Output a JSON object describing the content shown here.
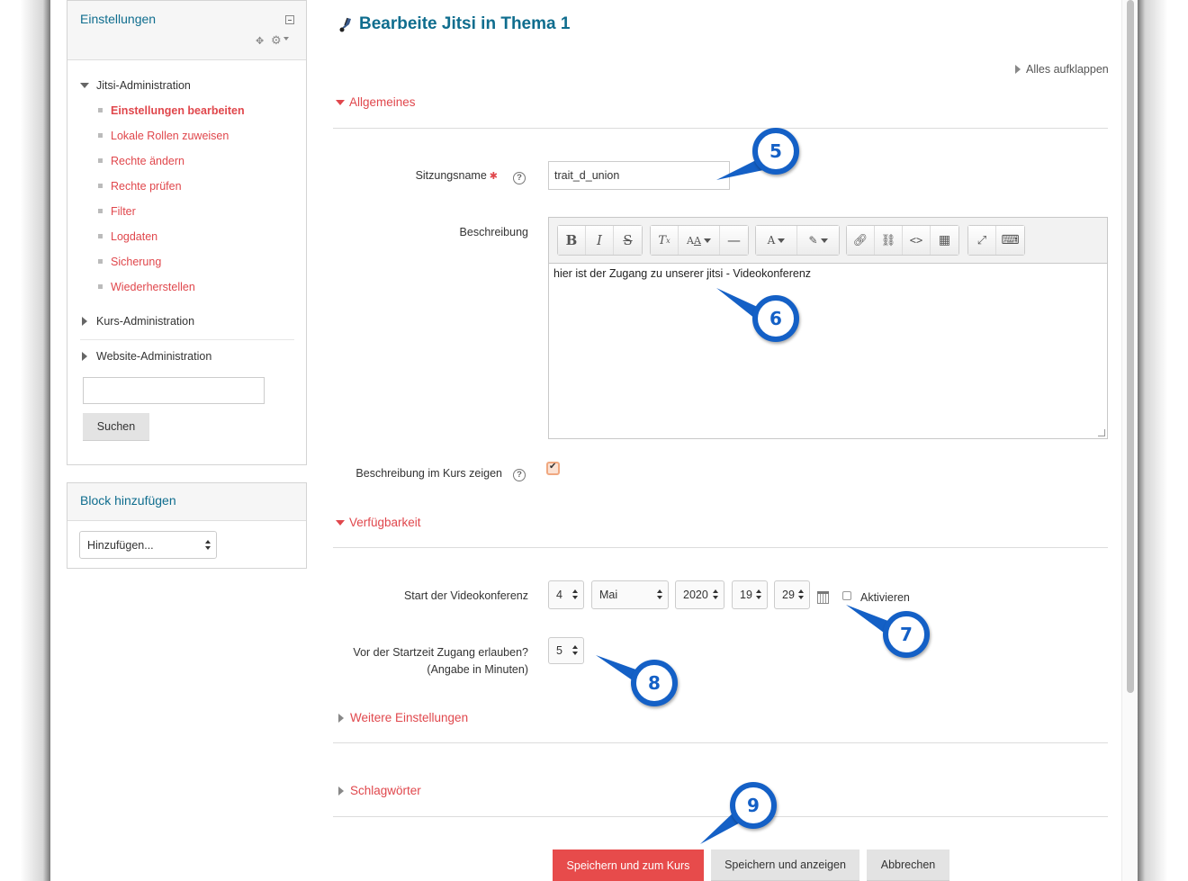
{
  "sidebar": {
    "settings_block": {
      "title": "Einstellungen",
      "tree": [
        {
          "label": "Jitsi-Administration",
          "expanded": true,
          "children": [
            {
              "label": "Einstellungen bearbeiten",
              "active": true
            },
            {
              "label": "Lokale Rollen zuweisen"
            },
            {
              "label": "Rechte ändern"
            },
            {
              "label": "Rechte prüfen"
            },
            {
              "label": "Filter"
            },
            {
              "label": "Logdaten"
            },
            {
              "label": "Sicherung"
            },
            {
              "label": "Wiederherstellen"
            }
          ]
        },
        {
          "label": "Kurs-Administration",
          "expanded": false
        },
        {
          "label": "Website-Administration",
          "expanded": false
        }
      ],
      "search_value": "",
      "search_button": "Suchen"
    },
    "add_block": {
      "title": "Block hinzufügen",
      "select_value": "Hinzufügen..."
    }
  },
  "main": {
    "title": "Bearbeite Jitsi in Thema 1",
    "expand_all": "Alles aufklappen",
    "sections": {
      "general": "Allgemeines",
      "availability": "Verfügbarkeit",
      "more_settings": "Weitere Einstellungen",
      "tags": "Schlagwörter"
    },
    "fields": {
      "session_name": {
        "label": "Sitzungsname",
        "value": "trait_d_union"
      },
      "description": {
        "label": "Beschreibung",
        "value": "hier ist der Zugang zu unserer jitsi - Videokonferenz"
      },
      "show_description": {
        "label": "Beschreibung im Kurs zeigen",
        "checked": true
      },
      "start": {
        "label": "Start der Videokonferenz",
        "day": "4",
        "month": "Mai",
        "year": "2020",
        "hour": "19",
        "minute": "29",
        "enable_label": "Aktivieren",
        "enabled": false
      },
      "early_access": {
        "label_line1": "Vor der Startzeit Zugang erlauben?",
        "label_line2": "(Angabe in Minuten)",
        "value": "5"
      }
    },
    "buttons": {
      "save_return": "Speichern und zum Kurs",
      "save_display": "Speichern und anzeigen",
      "cancel": "Abbrechen"
    }
  },
  "callouts": [
    "5",
    "6",
    "7",
    "8",
    "9"
  ],
  "colors": {
    "link_red": "#e0474c",
    "heading_blue": "#0f6d8e",
    "primary_button": "#e74b4b",
    "callout_blue": "#1460c6"
  }
}
